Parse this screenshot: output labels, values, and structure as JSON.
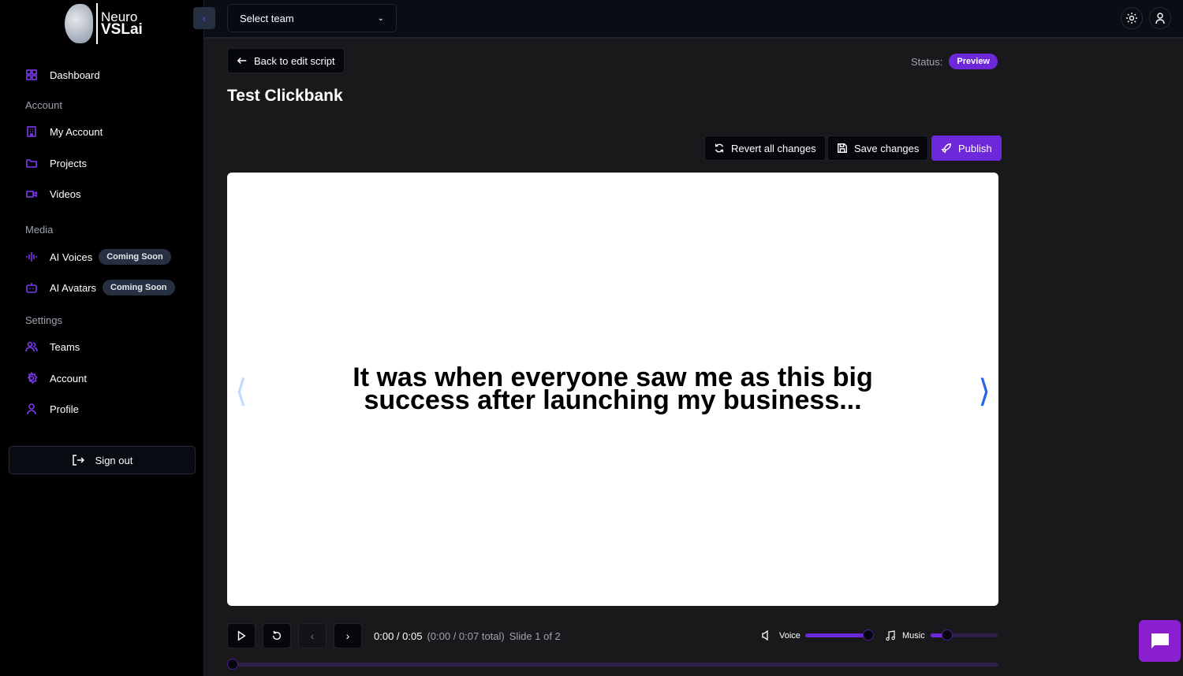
{
  "logo": {
    "line1": "Neuro",
    "line2": "VSLai"
  },
  "sidebar": {
    "dashboard": "Dashboard",
    "sections": {
      "account": "Account",
      "media": "Media",
      "settings": "Settings"
    },
    "items": {
      "my_account": "My Account",
      "projects": "Projects",
      "videos": "Videos",
      "ai_voices": "AI Voices",
      "ai_avatars": "AI Avatars",
      "teams": "Teams",
      "account": "Account",
      "profile": "Profile"
    },
    "coming_soon": "Coming Soon",
    "sign_out": "Sign out"
  },
  "topbar": {
    "team_select": "Select team"
  },
  "page": {
    "back": "Back to edit script",
    "title": "Test Clickbank",
    "status_label": "Status:",
    "status": "Preview",
    "revert": "Revert all changes",
    "save": "Save changes",
    "publish": "Publish"
  },
  "slide": {
    "text": "It was when everyone saw me as this big success after launching my business..."
  },
  "player": {
    "current": "0:00 / 0:05",
    "total": "(0:00 / 0:07 total)",
    "slide": "Slide 1 of 2",
    "voice_label": "Voice",
    "music_label": "Music",
    "voice_level": 1.0,
    "music_level": 0.25,
    "progress": 0
  },
  "colors": {
    "accent": "#6d28d9",
    "chat": "#8a1fd0"
  }
}
